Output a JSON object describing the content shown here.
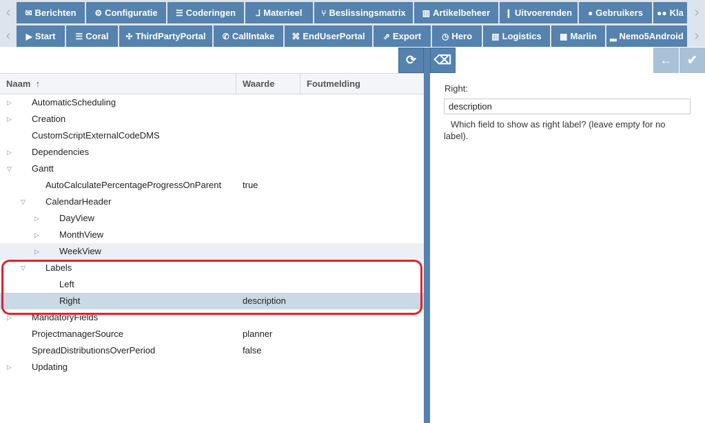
{
  "nav_row1": [
    {
      "label": "Berichten",
      "icon": "envelope-icon",
      "glyph": "✉"
    },
    {
      "label": "Configuratie",
      "icon": "gear-icon",
      "glyph": "⚙"
    },
    {
      "label": "Coderingen",
      "icon": "list-icon",
      "glyph": "☰"
    },
    {
      "label": "Materieel",
      "icon": "tool-icon",
      "glyph": "⅃"
    },
    {
      "label": "Beslissingsmatrix",
      "icon": "branch-icon",
      "glyph": "⑂"
    },
    {
      "label": "Artikelbeheer",
      "icon": "barcode-icon",
      "glyph": "▥"
    },
    {
      "label": "Uitvoerenden",
      "icon": "person-icon",
      "glyph": "❙"
    },
    {
      "label": "Gebruikers",
      "icon": "user-icon",
      "glyph": "●"
    },
    {
      "label": "Kla",
      "icon": "users-icon",
      "glyph": "●●"
    }
  ],
  "nav_row2": [
    {
      "label": "Start",
      "icon": "play-icon",
      "glyph": "▶"
    },
    {
      "label": "Coral",
      "icon": "sliders-icon",
      "glyph": "☰"
    },
    {
      "label": "ThirdPartyPortal",
      "icon": "pinwheel-icon",
      "glyph": "✣"
    },
    {
      "label": "CallIntake",
      "icon": "phone-icon",
      "glyph": "✆"
    },
    {
      "label": "EndUserPortal",
      "icon": "portal-icon",
      "glyph": "⌘"
    },
    {
      "label": "Export",
      "icon": "export-icon",
      "glyph": "⇗"
    },
    {
      "label": "Hero",
      "icon": "clock-icon",
      "glyph": "◷"
    },
    {
      "label": "Logistics",
      "icon": "barcode-icon",
      "glyph": "▥"
    },
    {
      "label": "Marlin",
      "icon": "calendar-icon",
      "glyph": "▦"
    },
    {
      "label": "Nemo5Android",
      "icon": "android-icon",
      "glyph": "▂"
    }
  ],
  "table": {
    "col_name": "Naam",
    "sort_glyph": "↑",
    "col_value": "Waarde",
    "col_error": "Foutmelding"
  },
  "rows": [
    {
      "name": "AutomaticScheduling",
      "value": "",
      "level": 0,
      "toggle": "▷"
    },
    {
      "name": "Creation",
      "value": "",
      "level": 0,
      "toggle": "▷"
    },
    {
      "name": "CustomScriptExternalCodeDMS",
      "value": "",
      "level": 0,
      "toggle": ""
    },
    {
      "name": "Dependencies",
      "value": "",
      "level": 0,
      "toggle": "▷"
    },
    {
      "name": "Gantt",
      "value": "",
      "level": 0,
      "toggle": "▽"
    },
    {
      "name": "AutoCalculatePercentageProgressOnParent",
      "value": "true",
      "level": 1,
      "toggle": ""
    },
    {
      "name": "CalendarHeader",
      "value": "",
      "level": 1,
      "toggle": "▽"
    },
    {
      "name": "DayView",
      "value": "",
      "level": 2,
      "toggle": "▷"
    },
    {
      "name": "MonthView",
      "value": "",
      "level": 2,
      "toggle": "▷"
    },
    {
      "name": "WeekView",
      "value": "",
      "level": 2,
      "toggle": "▷",
      "state": "hover"
    },
    {
      "name": "Labels",
      "value": "",
      "level": 1,
      "toggle": "▽"
    },
    {
      "name": "Left",
      "value": "",
      "level": 2,
      "toggle": ""
    },
    {
      "name": "Right",
      "value": "description",
      "level": 2,
      "toggle": "",
      "state": "sel"
    },
    {
      "name": "MandatoryFields",
      "value": "",
      "level": 0,
      "toggle": "▷"
    },
    {
      "name": "ProjectmanagerSource",
      "value": "planner",
      "level": 0,
      "toggle": ""
    },
    {
      "name": "SpreadDistributionsOverPeriod",
      "value": "false",
      "level": 0,
      "toggle": ""
    },
    {
      "name": "Updating",
      "value": "",
      "level": 0,
      "toggle": "▷"
    }
  ],
  "detail": {
    "label": "Right:",
    "value": "description",
    "help": "Which field to show as right label? (leave empty for no label)."
  },
  "glyphs": {
    "left": "‹",
    "right": "›",
    "refresh": "⟳",
    "eraser": "⌫",
    "back": "←",
    "check": "✔"
  }
}
